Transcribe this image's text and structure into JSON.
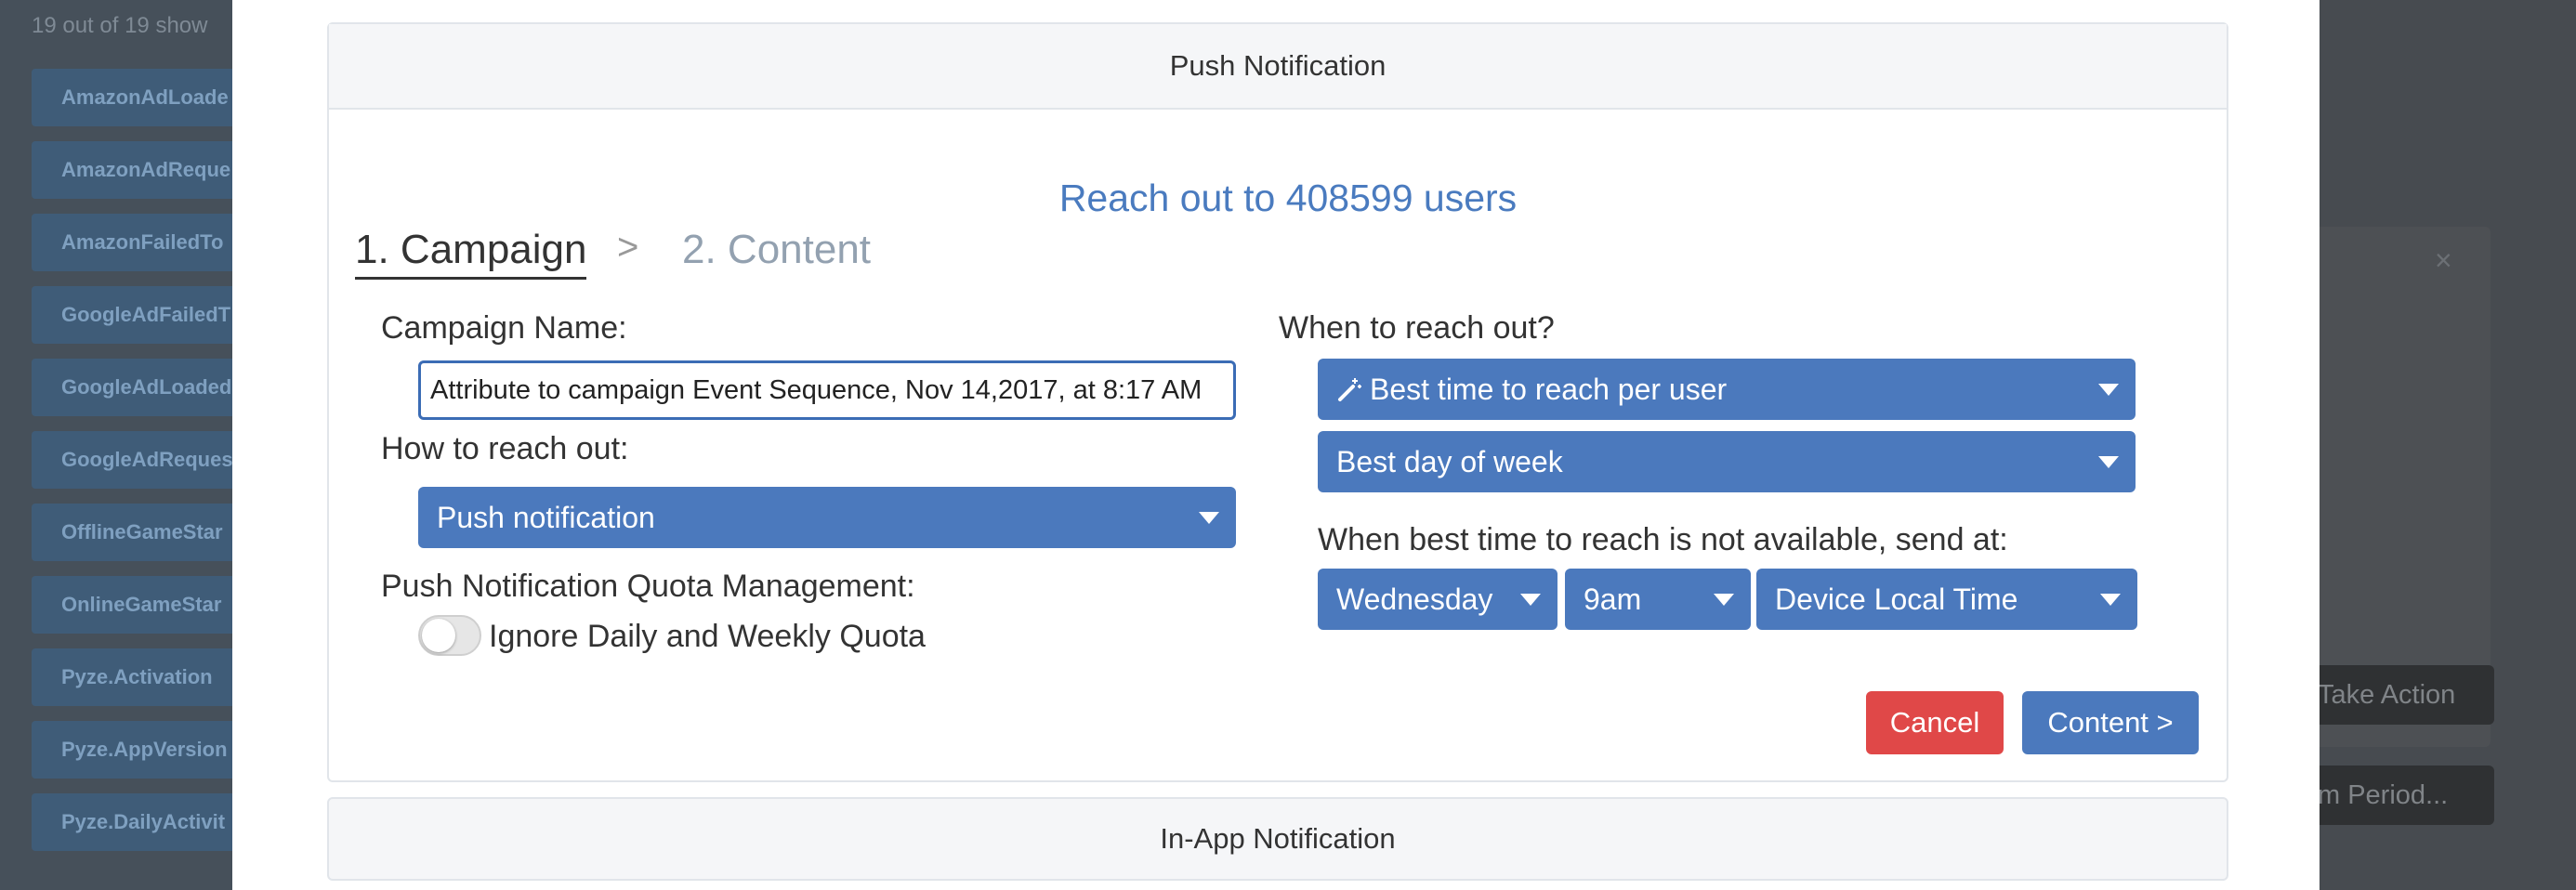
{
  "background": {
    "count_text": "19 out of 19 show",
    "event_list": [
      "AmazonAdLoade",
      "AmazonAdReque",
      "AmazonFailedTo",
      "GoogleAdFailedT",
      "GoogleAdLoaded",
      "GoogleAdReques",
      "OfflineGameStar",
      "OnlineGameStar",
      "Pyze.Activation",
      "Pyze.AppVersion",
      "Pyze.DailyActivit"
    ],
    "take_action_label": "Take Action",
    "period_label": "m Period...",
    "close_glyph": "×"
  },
  "modal": {
    "push_header": "Push Notification",
    "inapp_header": "In-App Notification",
    "reach_text": "Reach out to 408599 users",
    "steps": {
      "step1": "1. Campaign",
      "separator": ">",
      "step2": "2. Content"
    },
    "campaign_name_label": "Campaign Name:",
    "campaign_name_value": "Attribute to campaign Event Sequence, Nov 14,2017, at 8:17 AM",
    "how_label": "How to reach out:",
    "how_value": "Push notification",
    "quota_label": "Push Notification Quota Management:",
    "quota_toggle_label": "Ignore Daily and Weekly Quota",
    "quota_toggle_on": false,
    "when_label": "When to reach out?",
    "best_time_value": "Best time to reach per user",
    "best_day_value": "Best day of week",
    "fallback_label": "When best time to reach is not available, send at:",
    "fallback_day": "Wednesday",
    "fallback_time": "9am",
    "fallback_zone": "Device Local Time",
    "cancel_label": "Cancel",
    "content_label": "Content >"
  },
  "icons": {
    "best_time": "magic-wand-icon",
    "dropdown": "caret-down-icon"
  },
  "colors": {
    "accent": "#4b79bd",
    "cancel": "#e04848",
    "reach_text": "#4a7bbf"
  }
}
